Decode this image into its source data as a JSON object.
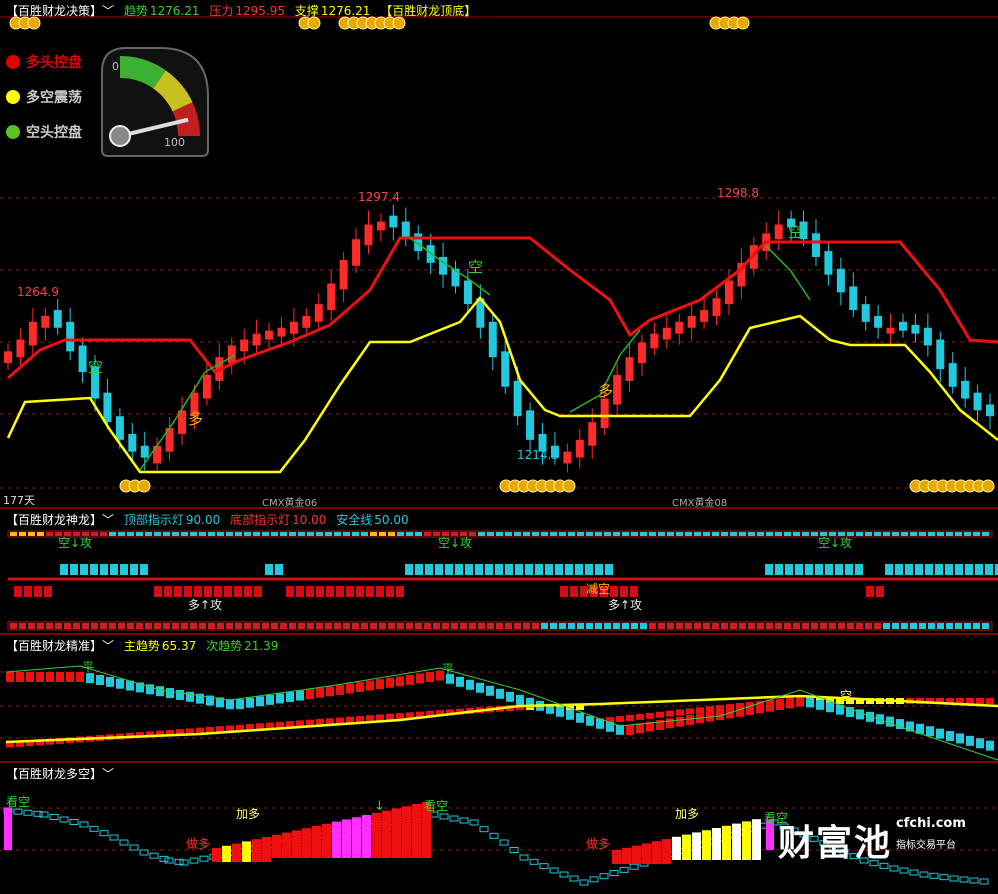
{
  "colors": {
    "up": "#ff2a2a",
    "down": "#22c8dc",
    "yellow": "#ffff00",
    "green": "#32d232",
    "grid": "#7a1a1a",
    "coin": "#e8a800"
  },
  "panel1": {
    "title": "【百胜财龙决策】",
    "trend_label": "趋势",
    "trend_value": "1276.21",
    "pressure_label": "压力",
    "pressure_value": "1295.95",
    "support_label": "支撑",
    "support_value": "1276.21",
    "extra": "【百胜财龙顶底】",
    "legend": [
      {
        "label": "多头控盘",
        "color": "#e00000"
      },
      {
        "label": "多空震荡",
        "color": "#ffff00"
      },
      {
        "label": "空头控盘",
        "color": "#5cc020"
      }
    ],
    "gauge": {
      "min_label": "0",
      "max_label": "100",
      "value": 85
    },
    "annotations": {
      "high1": "1264.9",
      "high2": "1297.4",
      "high3": "1298.8",
      "low1": "1214.3",
      "days": "177天",
      "contract1": "CMX黄金06",
      "contract2": "CMX黄金08",
      "sig_empty": "空",
      "sig_long": "多"
    }
  },
  "panel2": {
    "title": "【百胜财龙神龙】",
    "top_label": "顶部指示灯",
    "top_value": "90.00",
    "bottom_label": "底部指示灯",
    "bottom_value": "10.00",
    "safe_label": "安全线",
    "safe_value": "50.00",
    "sig_short": "空↓攻",
    "sig_long": "多↑攻",
    "sig_reduce": "减空"
  },
  "panel3": {
    "title": "【百胜财龙精准】",
    "main_label": "主趋势",
    "main_value": "65.37",
    "sub_label": "次趋势",
    "sub_value": "21.39",
    "sig_flat": "平",
    "sig_empty": "空"
  },
  "panel4": {
    "title": "【百胜财龙多空】",
    "sig_watch_short": "看空",
    "sig_add_long": "加多",
    "sig_do_long": "做多"
  },
  "watermark": {
    "brand": "财富池",
    "domain": "cfchi.com",
    "tagline": "指标交易平台"
  },
  "chart_data": {
    "type": "candlestick",
    "title": "【百胜财龙决策】",
    "annotated_prices": [
      1264.9,
      1297.4,
      1298.8,
      1214.3
    ],
    "indicator_values": {
      "trend": 1276.21,
      "pressure": 1295.95,
      "support": 1276.21,
      "top_light": 90.0,
      "bottom_light": 10.0,
      "safe_line": 50.0,
      "main_trend": 65.37,
      "sub_trend": 21.39
    },
    "close_path": [
      1252,
      1256,
      1262,
      1264,
      1260,
      1252,
      1245,
      1236,
      1228,
      1222,
      1218,
      1216,
      1220,
      1226,
      1232,
      1238,
      1244,
      1250,
      1254,
      1256,
      1258,
      1259,
      1260,
      1262,
      1264,
      1268,
      1275,
      1283,
      1290,
      1295,
      1296,
      1294,
      1290,
      1286,
      1282,
      1278,
      1274,
      1268,
      1260,
      1250,
      1240,
      1230,
      1222,
      1218,
      1216,
      1218,
      1222,
      1228,
      1236,
      1244,
      1250,
      1255,
      1258,
      1260,
      1262,
      1264,
      1266,
      1270,
      1276,
      1282,
      1288,
      1292,
      1295,
      1294,
      1290,
      1284,
      1278,
      1272,
      1266,
      1262,
      1260,
      1260,
      1259,
      1258,
      1254,
      1246,
      1240,
      1236,
      1232,
      1230
    ]
  }
}
